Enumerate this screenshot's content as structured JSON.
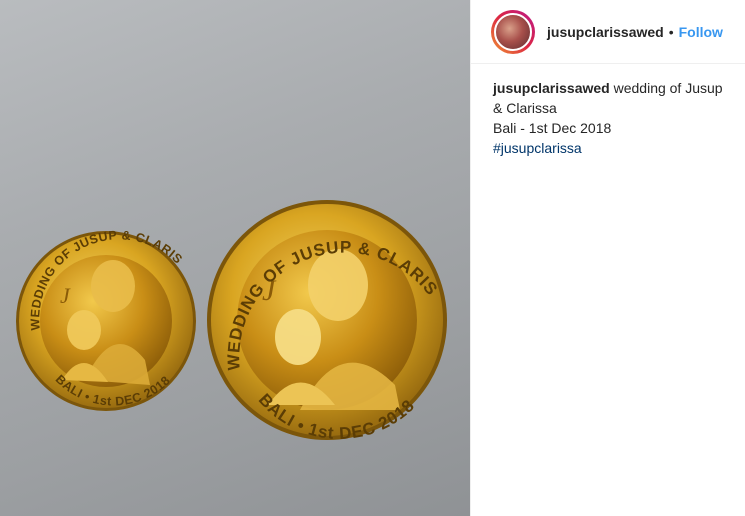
{
  "post": {
    "username": "jusupclarissawed",
    "separator": "•",
    "follow_label": "Follow",
    "caption_user": "jusupclarissawed",
    "caption_line1": "wedding of Jusup & Clarissa",
    "caption_line2": "Bali - 1st Dec 2018",
    "hashtag": "#jusupclarissa"
  },
  "coins": {
    "small": {
      "top_text": "WEDDING OF JUSUP & CLARISSA",
      "bottom_text": "BALI • 1st DEC 2018"
    },
    "large": {
      "top_text": "WEDDING OF JUSUP & CLARISSA",
      "bottom_text": "BALI • 1st DEC 2018"
    }
  },
  "colors": {
    "gold": "#d9a521",
    "follow": "#3897f0",
    "hashtag": "#003569",
    "text": "#262626"
  }
}
